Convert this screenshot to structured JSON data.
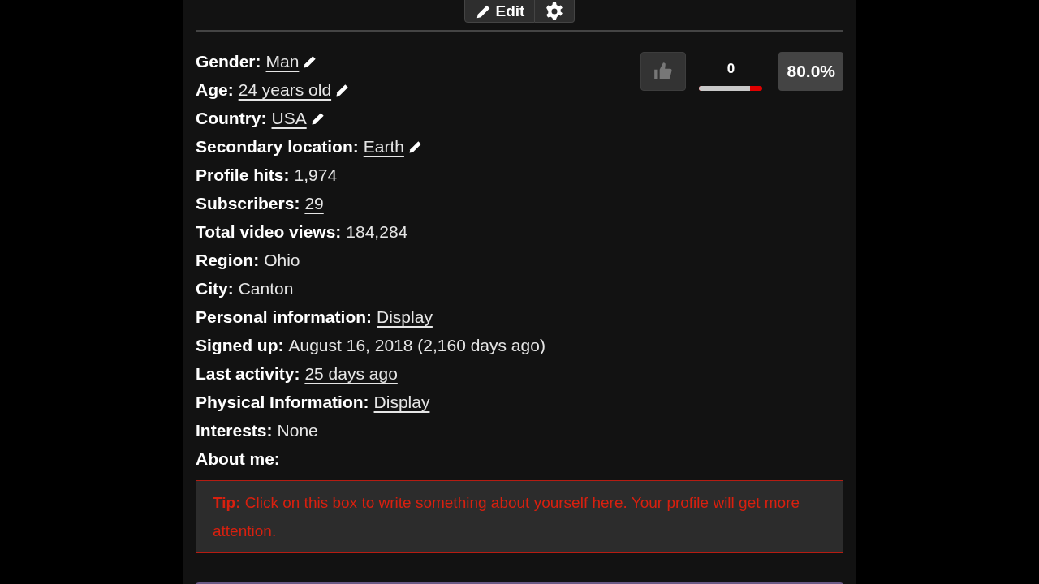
{
  "toolbar": {
    "edit_button": "Edit"
  },
  "fields": [
    {
      "label": "Gender:",
      "value": "Man",
      "kind": "link",
      "editable": true
    },
    {
      "label": "Age:",
      "value": "24 years old",
      "kind": "link",
      "editable": true
    },
    {
      "label": "Country:",
      "value": "USA",
      "kind": "link",
      "editable": true
    },
    {
      "label": "Secondary location:",
      "value": "Earth",
      "kind": "link",
      "editable": true
    },
    {
      "label": "Profile hits:",
      "value": "1,974",
      "kind": "plain"
    },
    {
      "label": "Subscribers:",
      "value": "29",
      "kind": "link"
    },
    {
      "label": "Total video views:",
      "value": "184,284",
      "kind": "plain"
    },
    {
      "label": "Region:",
      "value": "Ohio",
      "kind": "plain"
    },
    {
      "label": "City:",
      "value": "Canton",
      "kind": "plain"
    },
    {
      "label": "Personal information:",
      "value": "Display",
      "kind": "link"
    },
    {
      "label": "Signed up:",
      "value": "August 16, 2018 (2,160 days ago)",
      "kind": "plain"
    },
    {
      "label": "Last activity:",
      "value": "25 days ago",
      "kind": "link"
    },
    {
      "label": "Physical Information:",
      "value": "Display",
      "kind": "link"
    },
    {
      "label": "Interests:",
      "value": "None",
      "kind": "plain"
    },
    {
      "label": "About me:"
    }
  ],
  "rating": {
    "count": "0",
    "level": 0.8,
    "percent": "80.0%"
  },
  "tip": "**Tip:** Click on this box to write something about yourself here. Your profile will get more attention."
}
